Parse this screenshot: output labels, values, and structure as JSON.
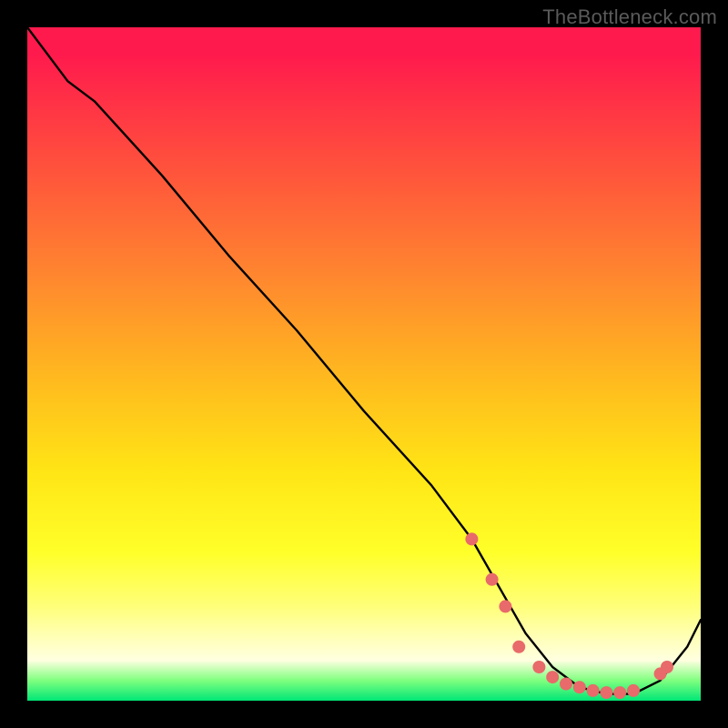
{
  "watermark": "TheBottleneck.com",
  "chart_data": {
    "type": "line",
    "title": "",
    "xlabel": "",
    "ylabel": "",
    "xlim": [
      0,
      100
    ],
    "ylim": [
      0,
      100
    ],
    "series": [
      {
        "name": "curve",
        "x": [
          0,
          6,
          10,
          20,
          30,
          40,
          50,
          60,
          66,
          70,
          74,
          78,
          82,
          86,
          90,
          94,
          98,
          100
        ],
        "y": [
          100,
          92,
          89,
          78,
          66,
          55,
          43,
          32,
          24,
          17,
          10,
          5,
          2,
          1,
          1,
          3,
          8,
          12
        ]
      }
    ],
    "markers": [
      {
        "x": 66,
        "y": 24
      },
      {
        "x": 69,
        "y": 18
      },
      {
        "x": 71,
        "y": 14
      },
      {
        "x": 73,
        "y": 8
      },
      {
        "x": 76,
        "y": 5
      },
      {
        "x": 78,
        "y": 3.5
      },
      {
        "x": 80,
        "y": 2.5
      },
      {
        "x": 82,
        "y": 2
      },
      {
        "x": 84,
        "y": 1.5
      },
      {
        "x": 86,
        "y": 1.2
      },
      {
        "x": 88,
        "y": 1.2
      },
      {
        "x": 90,
        "y": 1.5
      },
      {
        "x": 94,
        "y": 4
      },
      {
        "x": 95,
        "y": 5
      }
    ],
    "marker_color": "#e86a6a",
    "curve_color": "#000000"
  }
}
